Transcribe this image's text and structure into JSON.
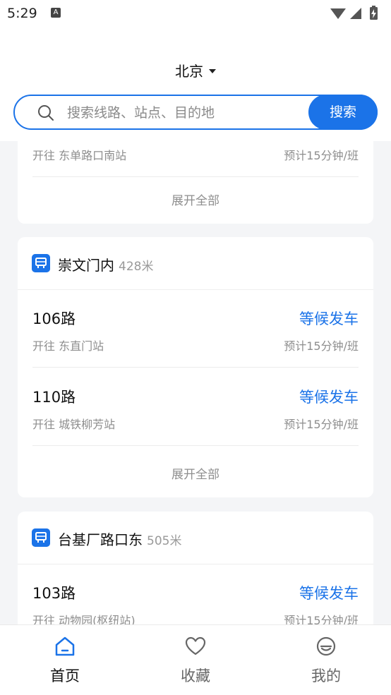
{
  "status_bar": {
    "time": "5:29",
    "a_badge": "A"
  },
  "header": {
    "city": "北京"
  },
  "search": {
    "placeholder": "搜索线路、站点、目的地",
    "button_label": "搜索"
  },
  "colors": {
    "accent": "#1b73e8",
    "muted": "#8e8e8e"
  },
  "stops": [
    {
      "name": "",
      "distance": "",
      "routes": [
        {
          "name": "",
          "status": "",
          "destination": "开往 东单路口南站",
          "frequency": "预计15分钟/班"
        }
      ],
      "expand_label": "展开全部"
    },
    {
      "name": "崇文门内",
      "distance": "428米",
      "icon": "bus-stop-icon",
      "routes": [
        {
          "name": "106路",
          "status": "等候发车",
          "destination": "开往 东直门站",
          "frequency": "预计15分钟/班"
        },
        {
          "name": "110路",
          "status": "等候发车",
          "destination": "开往 城铁柳芳站",
          "frequency": "预计15分钟/班"
        }
      ],
      "expand_label": "展开全部"
    },
    {
      "name": "台基厂路口东",
      "distance": "505米",
      "icon": "bus-stop-icon",
      "routes": [
        {
          "name": "103路",
          "status": "等候发车",
          "destination": "开往 动物园(枢纽站)",
          "frequency": "预计15分钟/班"
        }
      ]
    }
  ],
  "bottom_nav": [
    {
      "label": "首页",
      "icon": "home-icon",
      "active": true
    },
    {
      "label": "收藏",
      "icon": "heart-icon",
      "active": false
    },
    {
      "label": "我的",
      "icon": "profile-icon",
      "active": false
    }
  ]
}
